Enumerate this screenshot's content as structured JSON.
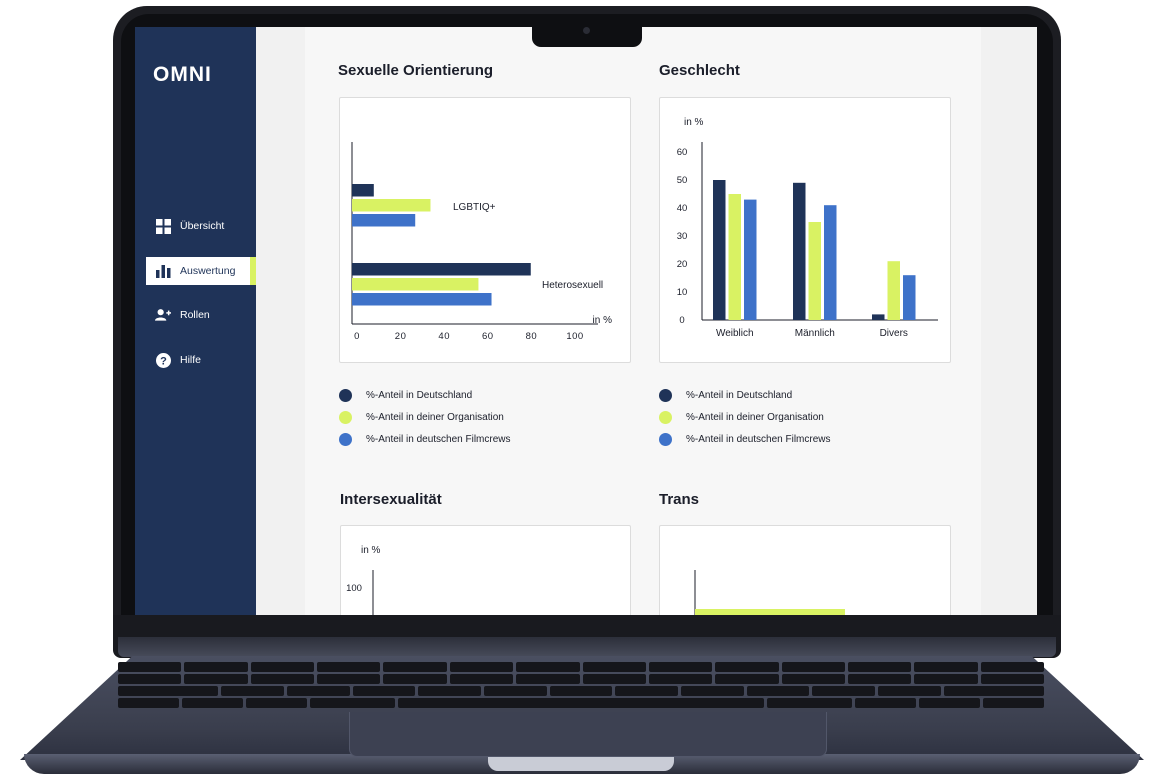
{
  "app": {
    "logo": "OMNI",
    "nav": [
      {
        "label": "Übersicht",
        "icon": "grid-icon"
      },
      {
        "label": "Auswertung",
        "icon": "bar-chart-icon"
      },
      {
        "label": "Rollen",
        "icon": "add-user-icon"
      },
      {
        "label": "Hilfe",
        "icon": "help-icon"
      }
    ],
    "active_nav": "Auswertung"
  },
  "colors": {
    "navy": "#1f3358",
    "lime": "#d9f263",
    "blue": "#3e72c9",
    "sidebar": "#1f3358"
  },
  "sections": {
    "orientation_title": "Sexuelle Orientierung",
    "gender_title": "Geschlecht",
    "intersex_title": "Intersexualität",
    "trans_title": "Trans"
  },
  "legend": [
    "%-Anteil in Deutschland",
    "%-Anteil in deiner Organisation",
    "%-Anteil in deutschen Filmcrews"
  ],
  "chart_data": [
    {
      "type": "bar",
      "orientation": "horizontal",
      "title": "Sexuelle Orientierung",
      "categories": [
        "LGBTIQ+",
        "Heterosexuell"
      ],
      "series": [
        {
          "name": "%-Anteil in Deutschland",
          "values": [
            10,
            82
          ]
        },
        {
          "name": "%-Anteil in deiner Organisation",
          "values": [
            36,
            58
          ]
        },
        {
          "name": "%-Anteil in deutschen Filmcrews",
          "values": [
            29,
            64
          ]
        }
      ],
      "xlabel": "in %",
      "xticks": [
        "0",
        "20",
        "40",
        "60",
        "80",
        "100"
      ],
      "xlim": [
        0,
        100
      ]
    },
    {
      "type": "bar",
      "title": "Geschlecht",
      "categories": [
        "Weiblich",
        "Männlich",
        "Divers"
      ],
      "series": [
        {
          "name": "%-Anteil in Deutschland",
          "values": [
            50,
            49,
            2
          ]
        },
        {
          "name": "%-Anteil in deiner Organisation",
          "values": [
            45,
            35,
            21
          ]
        },
        {
          "name": "%-Anteil in deutschen Filmcrews",
          "values": [
            43,
            41,
            16
          ]
        }
      ],
      "ylabel": "in %",
      "yticks": [
        "0",
        "10",
        "20",
        "30",
        "40",
        "50",
        "60"
      ],
      "ylim": [
        0,
        60
      ]
    },
    {
      "type": "bar",
      "title": "Intersexualität",
      "ylabel": "in %",
      "yticks": [
        "100"
      ]
    },
    {
      "type": "bar",
      "orientation": "horizontal",
      "title": "Trans"
    }
  ]
}
